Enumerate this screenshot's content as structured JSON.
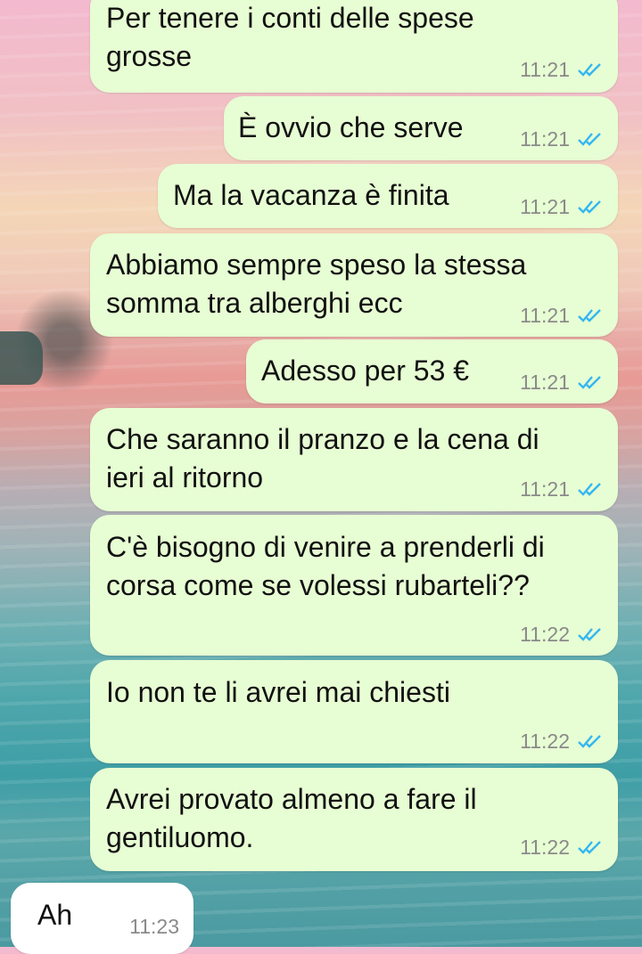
{
  "colors": {
    "outgoing_bubble": "#e7fdd3",
    "incoming_bubble": "#ffffff",
    "read_ticks": "#34b7f1",
    "timestamp": "#8a8a8a"
  },
  "messages": [
    {
      "lines": [
        "Per tenere i conti delle spese",
        "grosse"
      ],
      "time": "11:21",
      "status": "read-double-check-icon"
    },
    {
      "lines": [
        "È ovvio che serve"
      ],
      "time": "11:21",
      "status": "read-double-check-icon"
    },
    {
      "lines": [
        "Ma la vacanza è finita"
      ],
      "time": "11:21",
      "status": "read-double-check-icon"
    },
    {
      "lines": [
        "Abbiamo sempre speso la stessa",
        "somma tra alberghi ecc"
      ],
      "time": "11:21",
      "status": "read-double-check-icon"
    },
    {
      "lines": [
        "Adesso per 53 €"
      ],
      "time": "11:21",
      "status": "read-double-check-icon"
    },
    {
      "lines": [
        "Che saranno il pranzo e la cena di",
        "ieri al ritorno"
      ],
      "time": "11:21",
      "status": "read-double-check-icon"
    },
    {
      "lines": [
        "C'è bisogno di venire a prenderli di",
        "corsa come se volessi rubarteli??"
      ],
      "time": "11:22",
      "status": "read-double-check-icon"
    },
    {
      "lines": [
        "Io non te li avrei mai chiesti"
      ],
      "time": "11:22",
      "status": "read-double-check-icon"
    },
    {
      "lines": [
        "Avrei provato almeno a fare il",
        "gentiluomo."
      ],
      "time": "11:22",
      "status": "read-double-check-icon"
    },
    {
      "lines": [
        "Ah"
      ],
      "time": "11:23"
    }
  ]
}
